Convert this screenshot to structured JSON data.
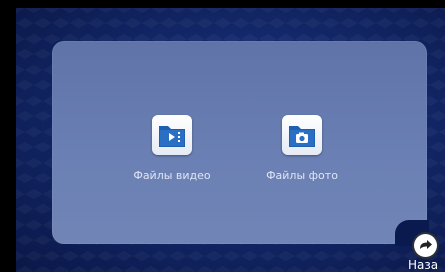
{
  "tiles": [
    {
      "label": "Файлы видео",
      "icon": "video-folder-icon"
    },
    {
      "label": "Файлы фото",
      "icon": "photo-folder-icon"
    }
  ],
  "back": {
    "label": "Наза",
    "icon": "back-arrow-icon"
  },
  "colors": {
    "background": "#13286a",
    "panel": "#6b80b4",
    "icon_accent": "#1f5fb2"
  }
}
